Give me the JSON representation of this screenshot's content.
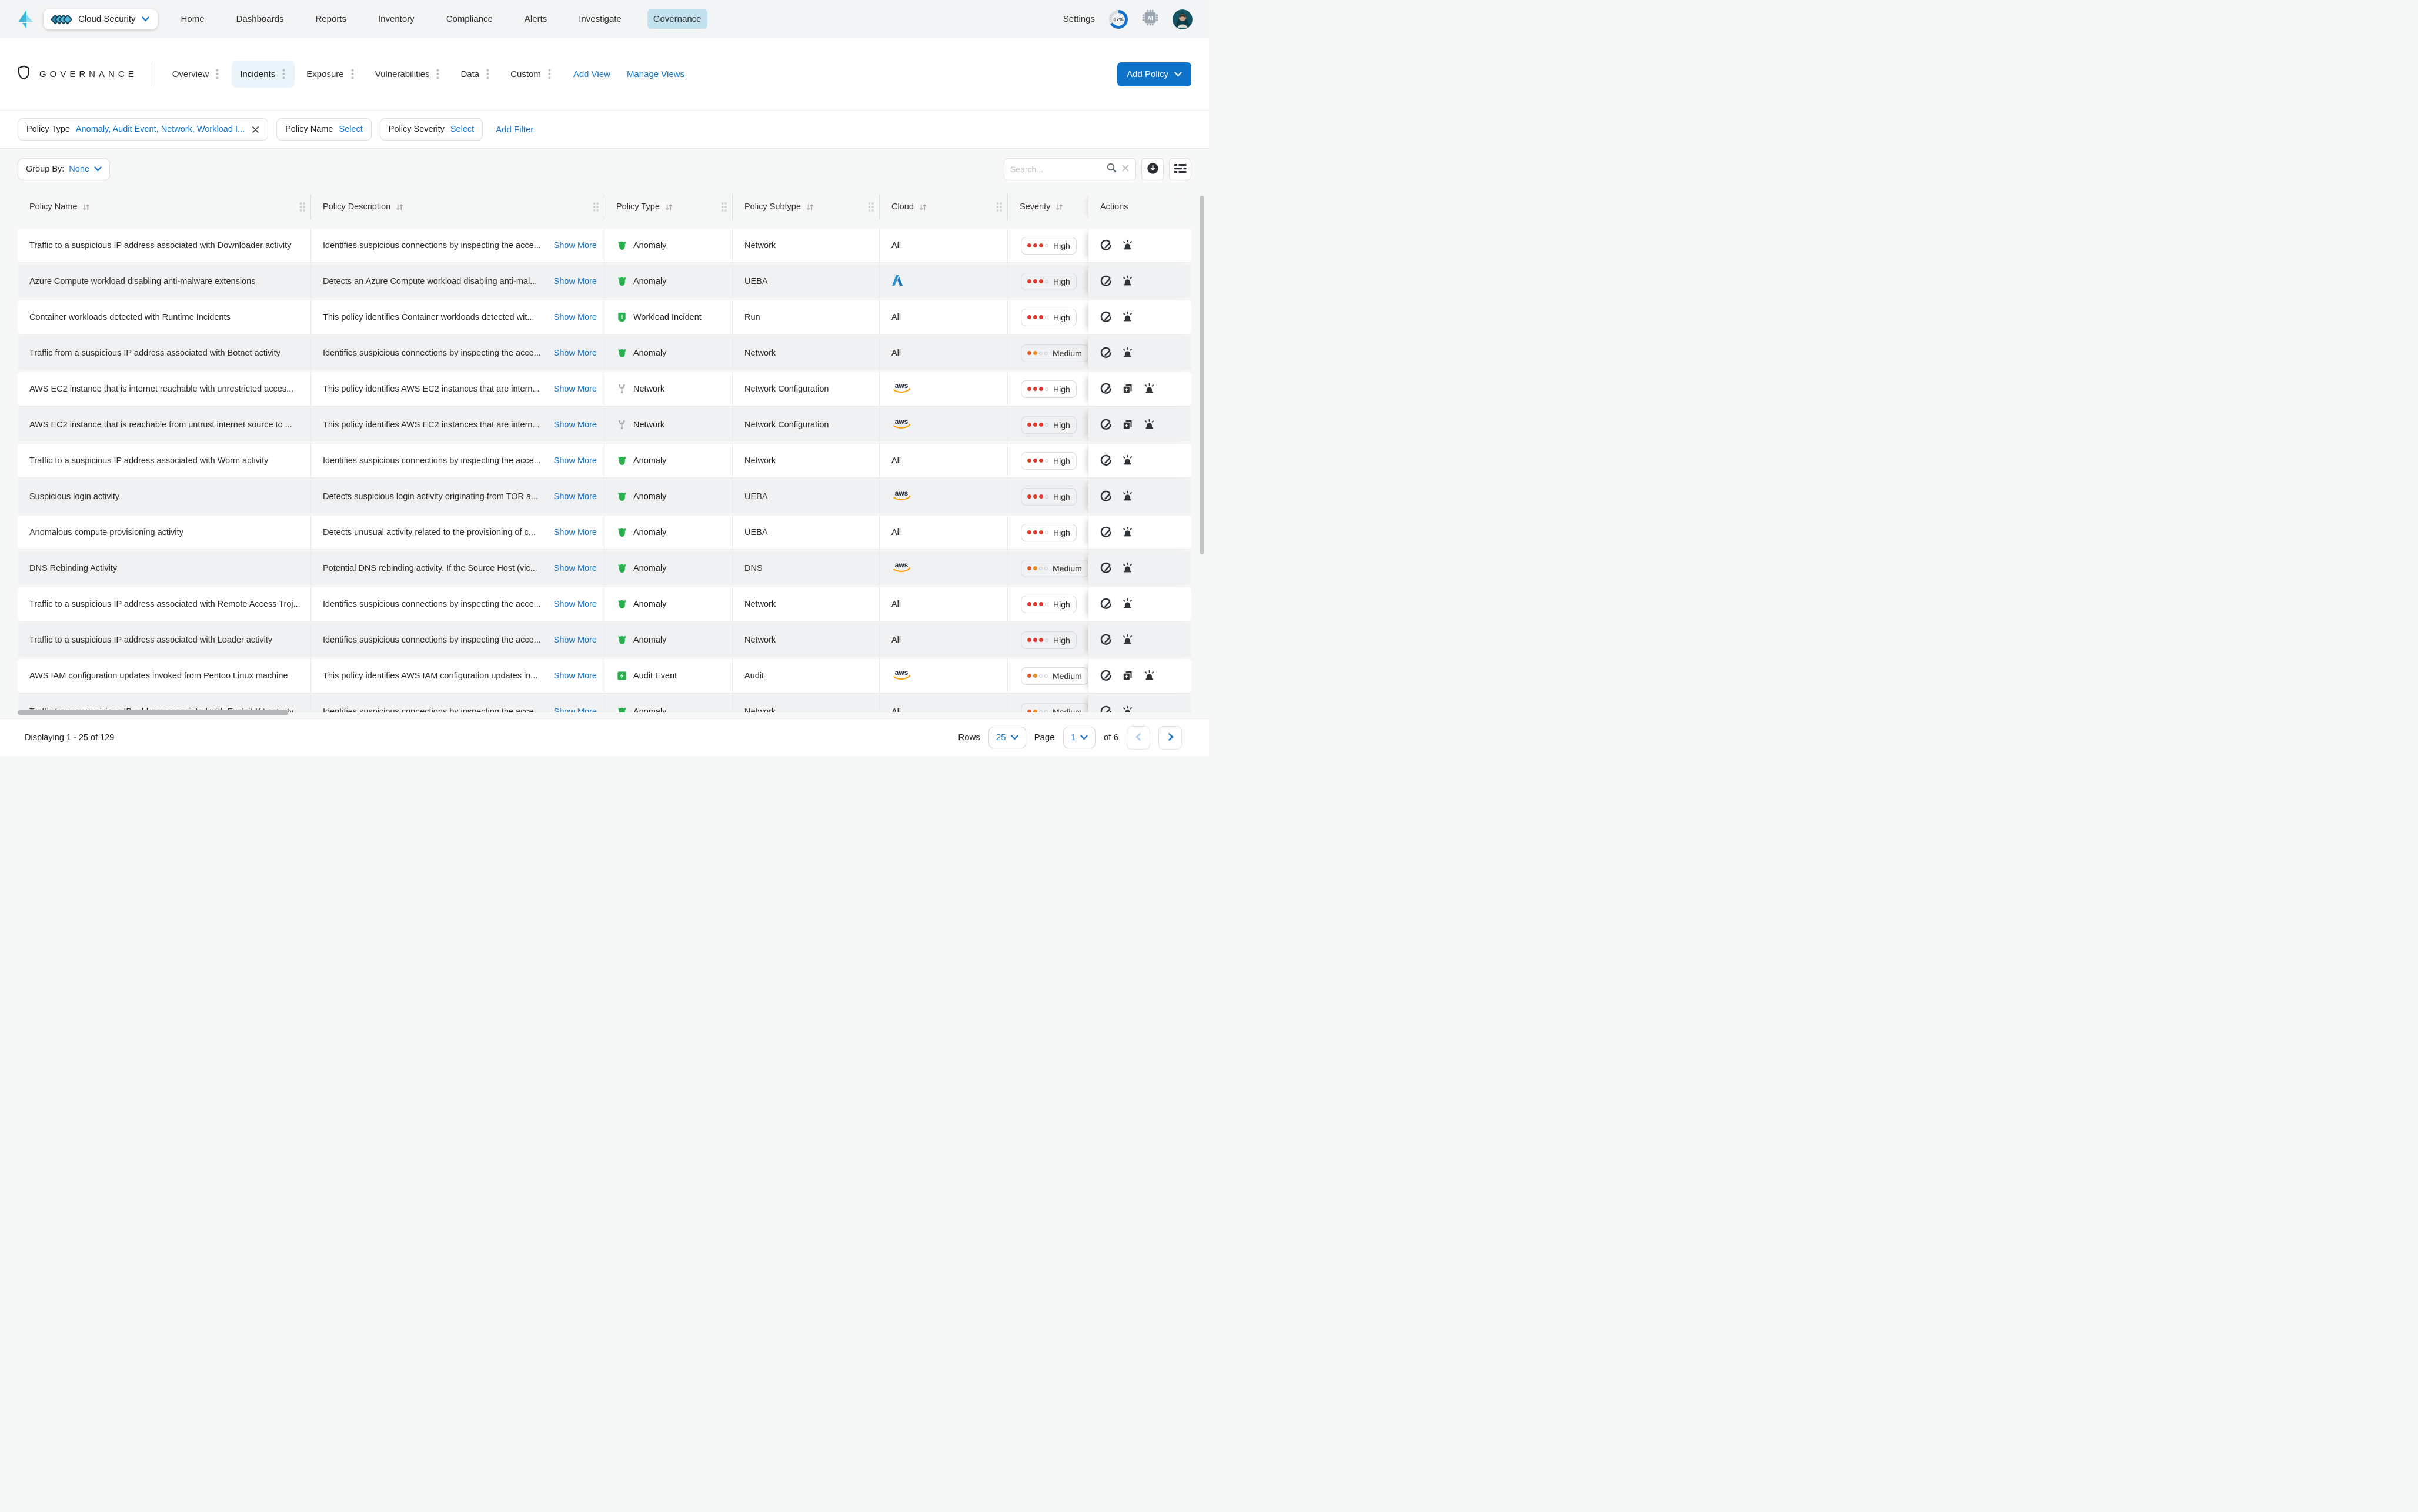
{
  "colors": {
    "accent": "#1372cb",
    "primary_button": "#0d72c8",
    "nav_active_bg": "#c3e2ef",
    "tab_active_bg": "#e9f4fb",
    "severity_high": "#e13b30",
    "severity_medium_1": "#e2592c",
    "severity_medium_2": "#f08b1e",
    "anomaly_green": "#26b14c",
    "aws_orange": "#ff9900",
    "aws_navy": "#252f3e"
  },
  "topnav": {
    "product_label": "Cloud Security",
    "items": [
      "Home",
      "Dashboards",
      "Reports",
      "Inventory",
      "Compliance",
      "Alerts",
      "Investigate",
      "Governance"
    ],
    "active_item": "Governance",
    "settings_label": "Settings",
    "progress_percent": "67%",
    "progress_value": 67
  },
  "header": {
    "title": "GOVERNANCE",
    "tabs": [
      "Overview",
      "Incidents",
      "Exposure",
      "Vulnerabilities",
      "Data",
      "Custom"
    ],
    "active_tab": "Incidents",
    "add_view_label": "Add View",
    "manage_views_label": "Manage Views",
    "add_policy_label": "Add Policy"
  },
  "filters": {
    "policy_type_label": "Policy Type",
    "policy_type_value": "Anomaly, Audit Event, Network, Workload I...",
    "policy_name_label": "Policy Name",
    "policy_name_value": "Select",
    "policy_severity_label": "Policy Severity",
    "policy_severity_value": "Select",
    "add_filter_label": "Add Filter"
  },
  "toolbar": {
    "group_by_label": "Group By:",
    "group_by_value": "None",
    "search_placeholder": "Search..."
  },
  "table": {
    "columns": [
      "Policy Name",
      "Policy Description",
      "Policy Type",
      "Policy Subtype",
      "Cloud",
      "Severity",
      "Actions"
    ],
    "show_more_label": "Show More",
    "rows": [
      {
        "name": "Traffic to a suspicious IP address associated with Downloader activity",
        "description": "Identifies suspicious connections by inspecting the acce...",
        "type": "Anomaly",
        "type_icon": "anomaly-icon",
        "subtype": "Network",
        "cloud": "All",
        "severity": "High",
        "actions": [
          "edit",
          "alarm"
        ]
      },
      {
        "name": "Azure Compute workload disabling anti-malware extensions",
        "description": "Detects an Azure Compute workload disabling anti-mal...",
        "type": "Anomaly",
        "type_icon": "anomaly-icon",
        "subtype": "UEBA",
        "cloud": "Azure",
        "severity": "High",
        "actions": [
          "edit",
          "alarm"
        ]
      },
      {
        "name": "Container workloads detected with Runtime Incidents",
        "description": "This policy identifies Container workloads detected wit...",
        "type": "Workload Incident",
        "type_icon": "workload-incident-icon",
        "subtype": "Run",
        "cloud": "All",
        "severity": "High",
        "actions": [
          "edit",
          "alarm"
        ]
      },
      {
        "name": "Traffic from a suspicious IP address associated with Botnet activity",
        "description": "Identifies suspicious connections by inspecting the acce...",
        "type": "Anomaly",
        "type_icon": "anomaly-icon",
        "subtype": "Network",
        "cloud": "All",
        "severity": "Medium",
        "actions": [
          "edit",
          "alarm"
        ]
      },
      {
        "name": "AWS EC2 instance that is internet reachable with unrestricted acces...",
        "description": "This policy identifies AWS EC2 instances that are intern...",
        "type": "Network",
        "type_icon": "network-icon",
        "subtype": "Network Configuration",
        "cloud": "AWS",
        "severity": "High",
        "actions": [
          "edit",
          "clone",
          "alarm"
        ]
      },
      {
        "name": "AWS EC2 instance that is reachable from untrust internet source to ...",
        "description": "This policy identifies AWS EC2 instances that are intern...",
        "type": "Network",
        "type_icon": "network-icon",
        "subtype": "Network Configuration",
        "cloud": "AWS",
        "severity": "High",
        "actions": [
          "edit",
          "clone",
          "alarm"
        ]
      },
      {
        "name": "Traffic to a suspicious IP address associated with Worm activity",
        "description": "Identifies suspicious connections by inspecting the acce...",
        "type": "Anomaly",
        "type_icon": "anomaly-icon",
        "subtype": "Network",
        "cloud": "All",
        "severity": "High",
        "actions": [
          "edit",
          "alarm"
        ]
      },
      {
        "name": "Suspicious login activity",
        "description": "Detects suspicious login activity originating from TOR a...",
        "type": "Anomaly",
        "type_icon": "anomaly-icon",
        "subtype": "UEBA",
        "cloud": "AWS",
        "severity": "High",
        "actions": [
          "edit",
          "alarm"
        ]
      },
      {
        "name": "Anomalous compute provisioning activity",
        "description": "Detects unusual activity related to the provisioning of c...",
        "type": "Anomaly",
        "type_icon": "anomaly-icon",
        "subtype": "UEBA",
        "cloud": "All",
        "severity": "High",
        "actions": [
          "edit",
          "alarm"
        ]
      },
      {
        "name": "DNS Rebinding Activity",
        "description": "Potential DNS rebinding activity. If the Source Host (vic...",
        "type": "Anomaly",
        "type_icon": "anomaly-icon",
        "subtype": "DNS",
        "cloud": "AWS",
        "severity": "Medium",
        "actions": [
          "edit",
          "alarm"
        ]
      },
      {
        "name": "Traffic to a suspicious IP address associated with Remote Access Troj...",
        "description": "Identifies suspicious connections by inspecting the acce...",
        "type": "Anomaly",
        "type_icon": "anomaly-icon",
        "subtype": "Network",
        "cloud": "All",
        "severity": "High",
        "actions": [
          "edit",
          "alarm"
        ]
      },
      {
        "name": "Traffic to a suspicious IP address associated with Loader activity",
        "description": "Identifies suspicious connections by inspecting the acce...",
        "type": "Anomaly",
        "type_icon": "anomaly-icon",
        "subtype": "Network",
        "cloud": "All",
        "severity": "High",
        "actions": [
          "edit",
          "alarm"
        ]
      },
      {
        "name": "AWS IAM configuration updates invoked from Pentoo Linux machine",
        "description": "This policy identifies AWS IAM configuration updates in...",
        "type": "Audit Event",
        "type_icon": "audit-event-icon",
        "subtype": "Audit",
        "cloud": "AWS",
        "severity": "Medium",
        "actions": [
          "edit",
          "clone",
          "alarm"
        ]
      },
      {
        "name": "Traffic from a suspicious IP address associated with Exploit Kit activity",
        "description": "Identifies suspicious connections by inspecting the acce...",
        "type": "Anomaly",
        "type_icon": "anomaly-icon",
        "subtype": "Network",
        "cloud": "All",
        "severity": "Medium",
        "actions": [
          "edit",
          "alarm"
        ]
      }
    ]
  },
  "footer": {
    "displaying_text": "Displaying 1 - 25 of 129",
    "rows_label": "Rows",
    "rows_per_page": "25",
    "page_label": "Page",
    "page_value": "1",
    "total_pages_label": "of 6"
  }
}
